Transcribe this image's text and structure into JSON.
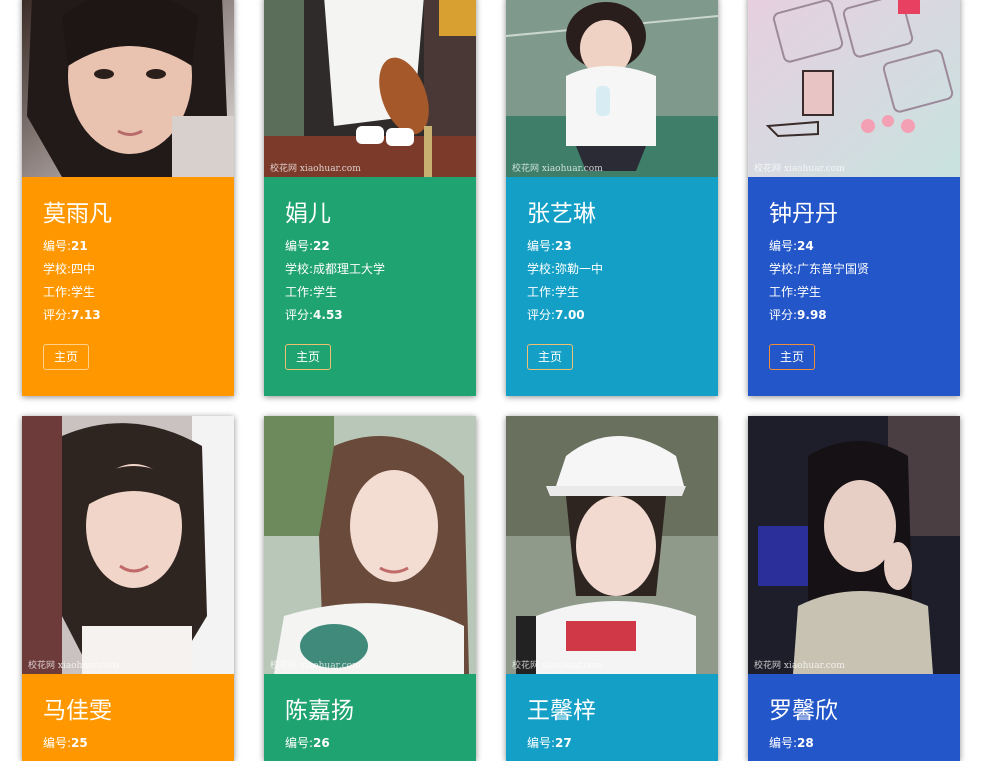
{
  "labels": {
    "id": "编号:",
    "school": "学校:",
    "job": "工作:",
    "score": "评分:",
    "home_button": "主页",
    "watermark": "校花网 xiaohuar.com"
  },
  "colors": {
    "orange": "#ff9800",
    "green": "#1fa371",
    "teal": "#14a0c6",
    "blue": "#2356c8"
  },
  "cards": [
    {
      "name": "莫雨凡",
      "id": "21",
      "school": "四中",
      "job": "学生",
      "score": "7.13",
      "color": "orange",
      "photo": "portrait-photo"
    },
    {
      "name": "娟儿",
      "id": "22",
      "school": "成都理工大学",
      "job": "学生",
      "score": "4.53",
      "color": "green",
      "photo": "sitting-photo"
    },
    {
      "name": "张艺琳",
      "id": "23",
      "school": "弥勒一中",
      "job": "学生",
      "score": "7.00",
      "color": "teal",
      "photo": "crouching-photo"
    },
    {
      "name": "钟丹丹",
      "id": "24",
      "school": "广东普宁国贤",
      "job": "学生",
      "score": "9.98",
      "color": "blue",
      "photo": "keyboard-illustration-photo"
    },
    {
      "name": "马佳雯",
      "id": "25",
      "color": "orange",
      "photo": "selfie-photo"
    },
    {
      "name": "陈嘉扬",
      "id": "26",
      "color": "green",
      "photo": "selfie-photo"
    },
    {
      "name": "王馨梓",
      "id": "27",
      "color": "teal",
      "photo": "cap-photo"
    },
    {
      "name": "罗馨欣",
      "id": "28",
      "color": "blue",
      "photo": "night-photo"
    }
  ]
}
